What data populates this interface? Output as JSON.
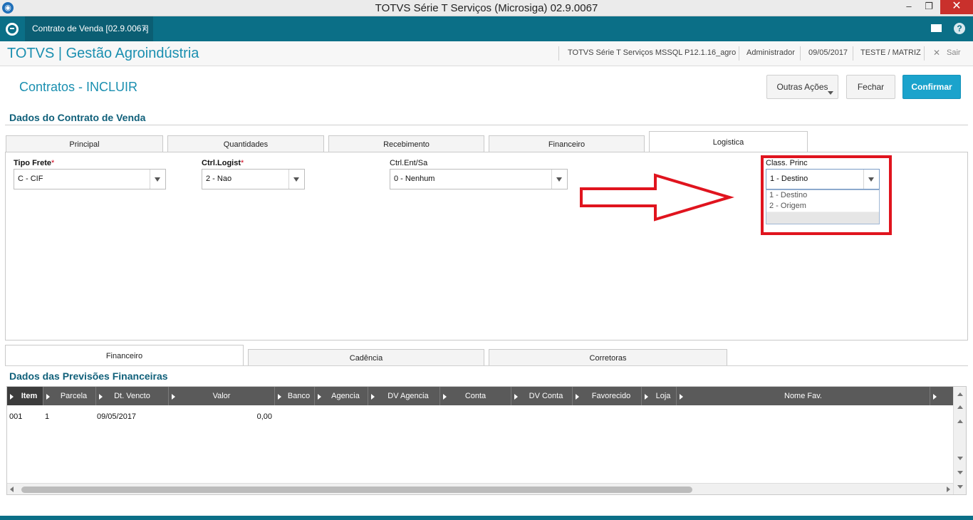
{
  "window": {
    "title": "TOTVS Série T Serviços (Microsiga) 02.9.0067"
  },
  "tabstrip": {
    "active_tab": "Contrato de Venda [02.9.0067]",
    "tab_close": "×"
  },
  "header": {
    "brand": "TOTVS | Gestão Agroindústria",
    "environment": "TOTVS Série T Serviços MSSQL P12.1.16_agro",
    "user": "Administrador",
    "date": "09/05/2017",
    "company": "TESTE / MATRIZ",
    "exit_label": "Sair"
  },
  "page": {
    "title": "Contratos - INCLUIR"
  },
  "actions": {
    "more": "Outras Ações",
    "close": "Fechar",
    "confirm": "Confirmar"
  },
  "contract": {
    "section_title": "Dados do Contrato de Venda",
    "tabs": [
      "Principal",
      "Quantidades",
      "Recebimento",
      "Financeiro",
      "Logistica"
    ],
    "active_tab": "Logistica",
    "fields": {
      "tipo_frete": {
        "label": "Tipo Frete",
        "required_mark": "*",
        "value": "C - CIF"
      },
      "ctrl_logist": {
        "label": "Ctrl.Logist",
        "required_mark": "*",
        "value": "2 - Nao"
      },
      "ctrl_ent_sa": {
        "label": "Ctrl.Ent/Sa",
        "value": "0 - Nenhum"
      },
      "class_princ": {
        "label": "Class. Princ",
        "value": "1 - Destino",
        "options": [
          "1 - Destino",
          "2 - Origem"
        ]
      }
    }
  },
  "lower": {
    "tabs": [
      "Financeiro",
      "Cadência",
      "Corretoras"
    ],
    "active_tab": "Financeiro",
    "section_title": "Dados das Previsões Financeiras",
    "columns": [
      "Item",
      "Parcela",
      "Dt. Vencto",
      "Valor",
      "Banco",
      "Agencia",
      "DV Agencia",
      "Conta",
      "DV Conta",
      "Favorecido",
      "Loja",
      "Nome Fav."
    ],
    "rows": [
      {
        "item": "001",
        "parcela": "1",
        "vencto": "09/05/2017",
        "valor": "0,00"
      }
    ]
  },
  "colors": {
    "accent": "#1a8fb0",
    "toolbar": "#0b6f87",
    "confirm": "#1ba3cc",
    "highlight": "#e0141e"
  }
}
